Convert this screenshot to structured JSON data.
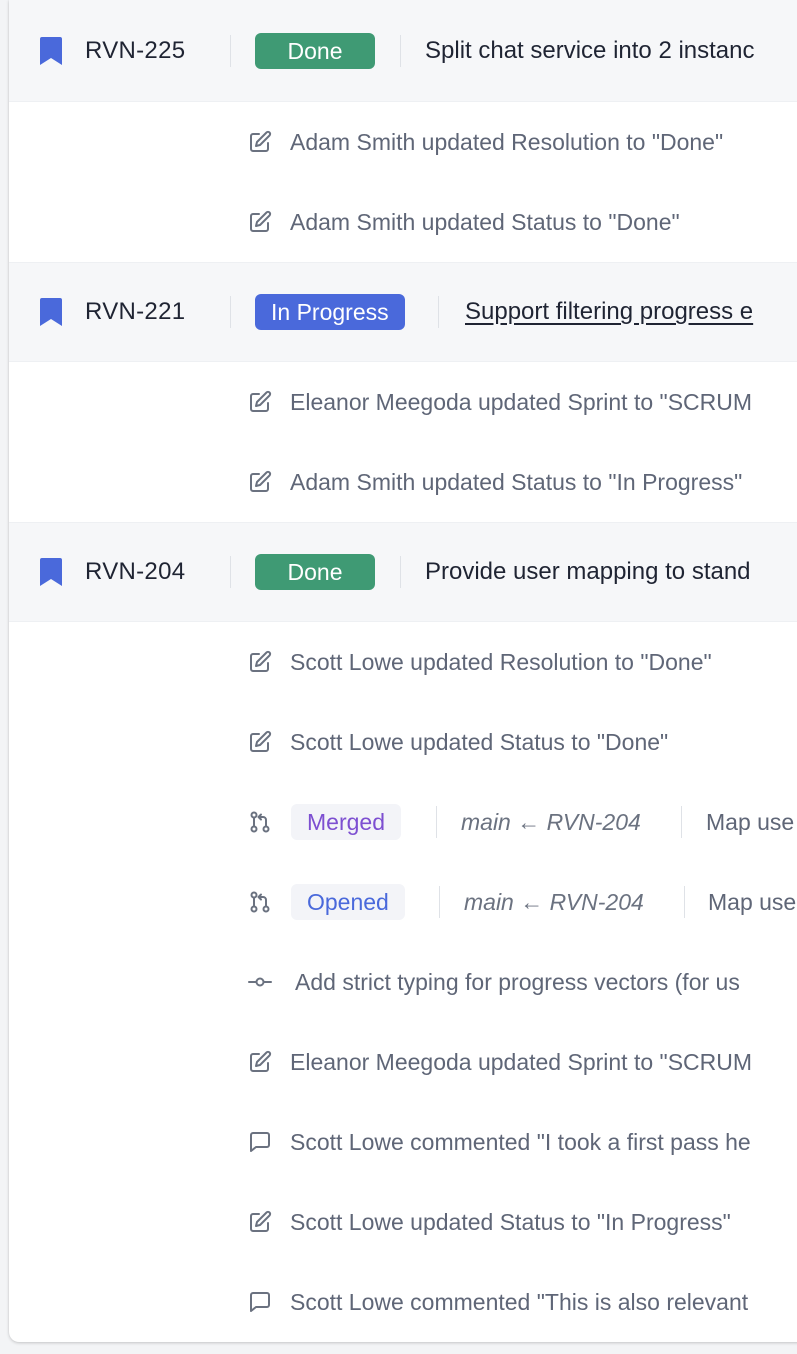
{
  "issues": [
    {
      "key": "RVN-225",
      "status": "Done",
      "title": "Split chat service into 2 instanc",
      "events": [
        {
          "icon": "edit-icon",
          "text": "Adam Smith updated Resolution to \"Done\""
        },
        {
          "icon": "edit-icon",
          "text": "Adam Smith updated Status to \"Done\""
        }
      ]
    },
    {
      "key": "RVN-221",
      "status": "In Progress",
      "title": "Support filtering progress e",
      "events": [
        {
          "icon": "edit-icon",
          "text": "Eleanor Meegoda updated Sprint to \"SCRUM"
        },
        {
          "icon": "edit-icon",
          "text": "Adam Smith updated Status to \"In Progress\""
        }
      ]
    },
    {
      "key": "RVN-204",
      "status": "Done",
      "title": "Provide user mapping to stand",
      "events": [
        {
          "icon": "edit-icon",
          "text": "Scott Lowe updated Resolution to \"Done\""
        },
        {
          "icon": "edit-icon",
          "text": "Scott Lowe updated Status to \"Done\""
        },
        {
          "icon": "pull-request-icon",
          "badge": "Merged",
          "branch": "main ← RVN-204",
          "text": "Map use"
        },
        {
          "icon": "pull-request-icon",
          "badge": "Opened",
          "branch": "main ← RVN-204",
          "text": "Map use"
        },
        {
          "icon": "commit-icon",
          "text": "Add strict typing for progress vectors (for us"
        },
        {
          "icon": "edit-icon",
          "text": "Eleanor Meegoda updated Sprint to \"SCRUM"
        },
        {
          "icon": "comment-icon",
          "text": "Scott Lowe commented \"I took a first pass he"
        },
        {
          "icon": "edit-icon",
          "text": "Scott Lowe updated Status to \"In Progress\""
        },
        {
          "icon": "comment-icon",
          "text": "Scott Lowe commented \"This is also relevant"
        }
      ]
    }
  ],
  "colors": {
    "done": "#3f9a74",
    "in_progress": "#4a69db",
    "merged": "#7d4fd1",
    "opened": "#4a69db",
    "bookmark": "#4a69db"
  }
}
